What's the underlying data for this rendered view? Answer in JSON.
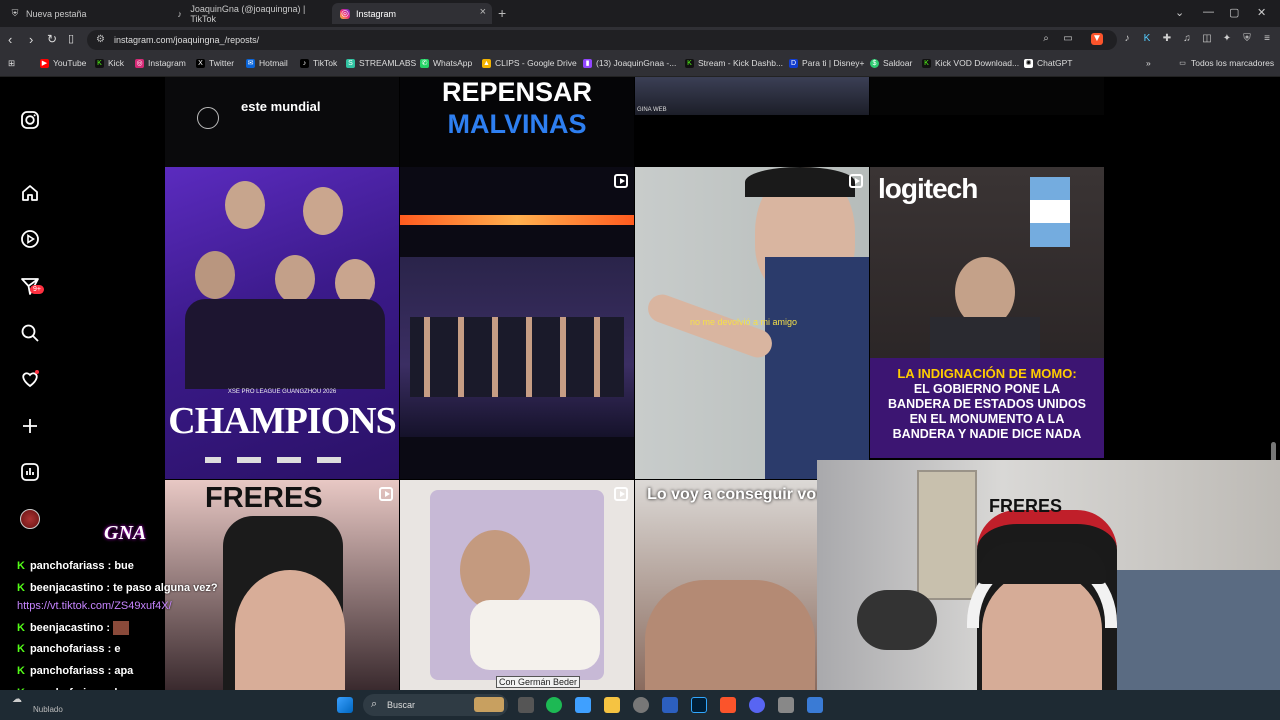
{
  "browser": {
    "tabs": [
      {
        "label": "Nueva pestaña",
        "icon": "shield-icon"
      },
      {
        "label": "JoaquinGna (@joaquingna) | TikTok",
        "icon": "tiktok-icon"
      },
      {
        "label": "Instagram",
        "icon": "instagram-icon"
      }
    ],
    "url": "instagram.com/joaquingna_/reposts/",
    "bookmarks": [
      "YouTube",
      "Kick",
      "Instagram",
      "Twitter",
      "Hotmail",
      "TikTok",
      "STREAMLABS",
      "WhatsApp",
      "CLIPS - Google Drive",
      "(13) JoaquinGnaa -...",
      "Stream - Kick Dashb...",
      "Para ti | Disney+",
      "Saldoar",
      "Kick VOD Download...",
      "ChatGPT"
    ],
    "all_bookmarks": "Todos los marcadores"
  },
  "sidebar": {
    "notification_count": "9+"
  },
  "posts": {
    "top_left_text": "este mundial",
    "top_mid_text_1": "REPENSAR",
    "top_mid_text_2": "MALVINAS",
    "top_right_tag": "GINA WEB",
    "champions_title": "CHAMPIONS",
    "champions_sub": "XSE PRO LEAGUE GUANGZHOU 2026",
    "clip_caption": "no me devolvió a mi amigo",
    "logitech": "logitech",
    "momo_text": "LA INDIGNACIÓN DE MOMO:",
    "momo_text_2": "EL GOBIERNO PONE LA BANDERA DE ESTADOS UNIDOS EN EL MONUMENTO A LA BANDERA Y NADIE DICE NADA",
    "freres": "FRERES",
    "beder": "Con Germán Beder",
    "conseguir": "Lo voy a conseguir vos",
    "heart": "❣"
  },
  "stream": {
    "logo": "GNA",
    "chat": [
      {
        "user": "panchofariass",
        "text": ": bue"
      },
      {
        "user": "beenjacastino",
        "text": ": te paso alguna vez?"
      },
      {
        "user": "",
        "text": "https://vt.tiktok.com/ZS49xuf4X/"
      },
      {
        "user": "beenjacastino",
        "text": ":"
      },
      {
        "user": "panchofariass",
        "text": ": e"
      },
      {
        "user": "panchofariass",
        "text": ": apa"
      },
      {
        "user": "panchofariass",
        "text": ": bue"
      }
    ],
    "cam_sign": "FRERES"
  },
  "taskbar": {
    "weather": "Nublado",
    "search": "Buscar"
  }
}
